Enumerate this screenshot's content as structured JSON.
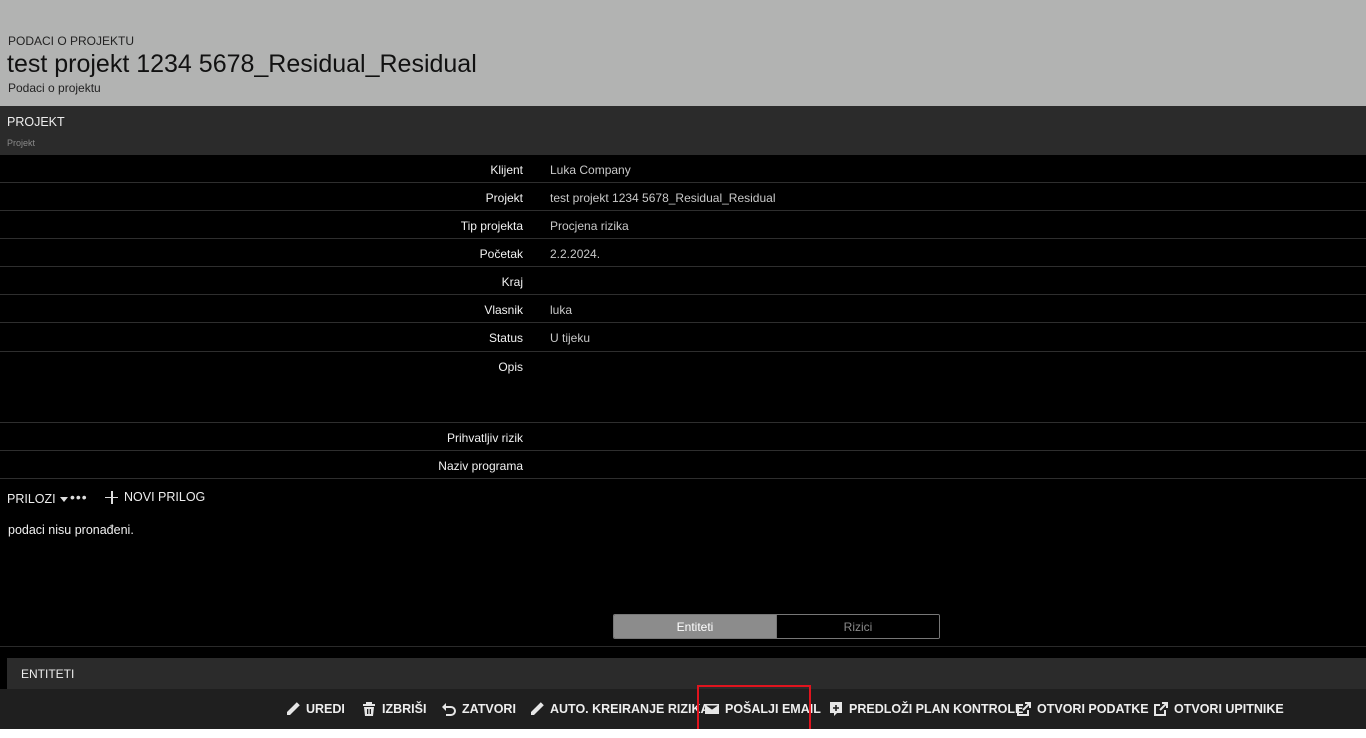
{
  "header": {
    "kicker": "PODACI O PROJEKTU",
    "title": "test projekt 1234 5678_Residual_Residual",
    "subtitle": "Podaci o projektu"
  },
  "section": {
    "title": "PROJEKT",
    "subtitle": "Projekt"
  },
  "fields": [
    {
      "label": "Klijent",
      "value": "Luka Company"
    },
    {
      "label": "Projekt",
      "value": "test projekt 1234 5678_Residual_Residual"
    },
    {
      "label": "Tip projekta",
      "value": "Procjena rizika"
    },
    {
      "label": "Početak",
      "value": "2.2.2024."
    },
    {
      "label": "Kraj",
      "value": ""
    },
    {
      "label": "Vlasnik",
      "value": "luka"
    },
    {
      "label": "Status",
      "value": "U tijeku"
    },
    {
      "label": "Opis",
      "value": ""
    },
    {
      "label": "Prihvatljiv rizik",
      "value": ""
    },
    {
      "label": "Naziv programa",
      "value": ""
    }
  ],
  "attachments": {
    "menu_label": "PRILOZI",
    "more_label": "•••",
    "new_label": "NOVI PRILOG",
    "empty_text": "podaci nisu pronađeni."
  },
  "tabs": {
    "active": "Entiteti",
    "inactive": "Rizici"
  },
  "entities_bar": {
    "title": "ENTITETI"
  },
  "toolbar": {
    "edit": "UREDI",
    "delete": "IZBRIŠI",
    "close": "ZATVORI",
    "auto_risk": "AUTO. KREIRANJE RIZIKA",
    "send_email": "POŠALJI EMAIL",
    "submit_plan": "PREDLOŽI PLAN KONTROLE",
    "open_data": "OTVORI PODATKE",
    "open_questionnaires": "OTVORI UPITNIKE"
  },
  "colors": {
    "highlight": "#e0141e",
    "header_bg": "#b2b3b2",
    "panel_bg": "#000000"
  }
}
